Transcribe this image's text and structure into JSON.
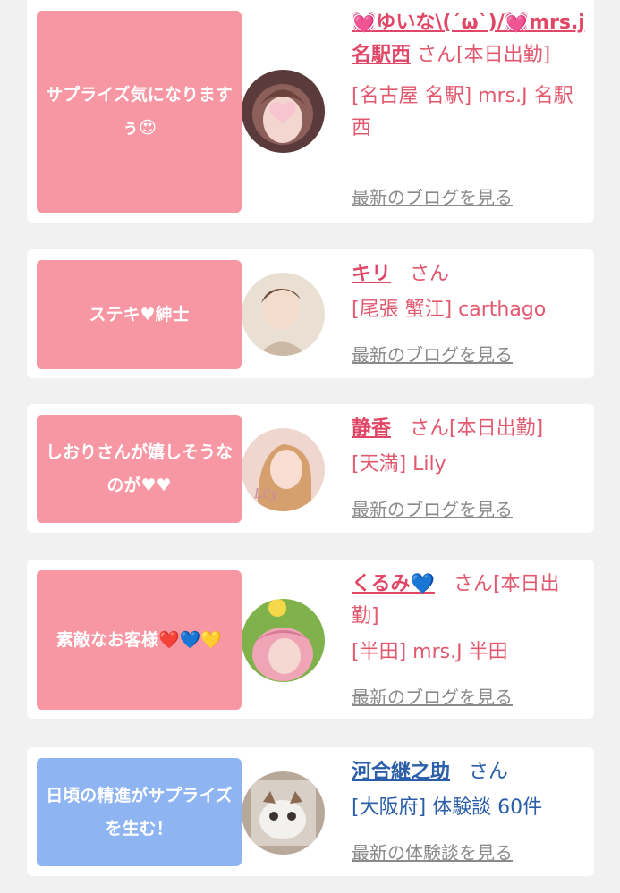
{
  "cards": [
    {
      "bubble": "サプライズ気になりますぅ😍",
      "name": "💓ゆいな\\(´ω`)/💓mrs.j名駅西",
      "san": "さん[本日出勤]",
      "shop": "[名古屋 名駅] mrs.J 名駅西",
      "link": "最新のブログを見る"
    },
    {
      "bubble": "ステキ♥紳士",
      "name": "キリ",
      "san": "さん",
      "shop": "[尾張 蟹江] carthago",
      "link": "最新のブログを見る"
    },
    {
      "bubble": "しおりさんが嬉しそうなのが♥♥",
      "name": "静香",
      "san": "さん[本日出勤]",
      "shop": "[天満] Lily",
      "link": "最新のブログを見る"
    },
    {
      "bubble": "素敵なお客様❤️💙💛",
      "name": "くるみ💙",
      "san": "さん[本日出勤]",
      "shop": "[半田] mrs.J 半田",
      "link": "最新のブログを見る"
    },
    {
      "bubble": "日頃の精進がサプライズを生む！",
      "name": "河合継之助",
      "san": "さん",
      "shop": "[大阪府] 体験談 60件",
      "link": "最新の体験談を見る"
    }
  ],
  "colors": {
    "pink_bubble": "#f897a4",
    "blue_bubble": "#8eb4f2",
    "pink_text": "#e2586e",
    "blue_text": "#2a5ea8",
    "link_gray": "#8a8a8a"
  }
}
